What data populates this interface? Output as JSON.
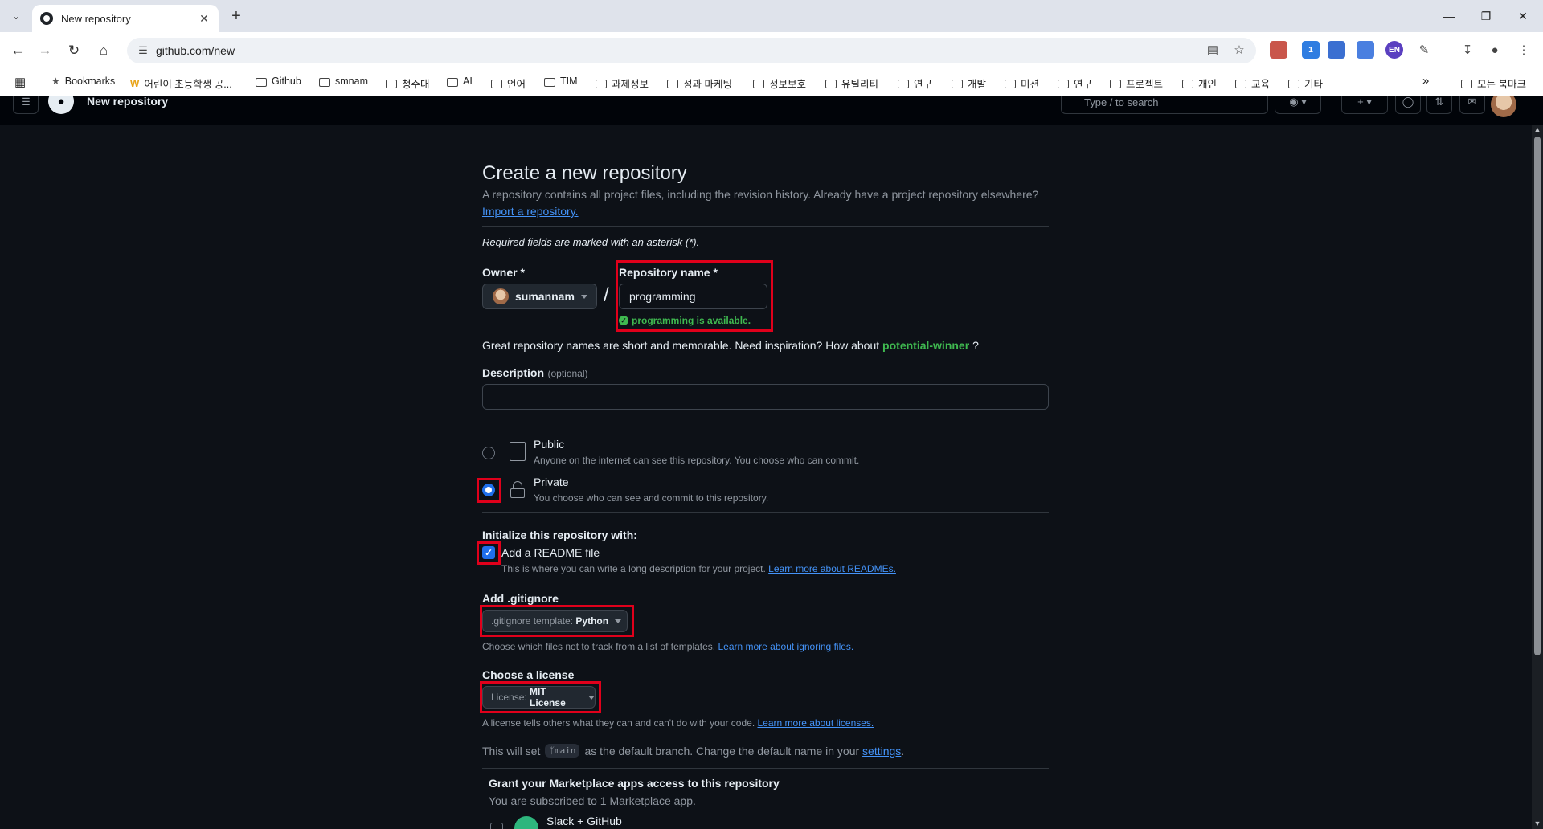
{
  "browser": {
    "tab_title": "New repository",
    "url": "github.com/new",
    "extension_badge": "1",
    "extension_en": "EN",
    "bookmarks": [
      "Bookmarks",
      "어린이 초등학생 공...",
      "Github",
      "smnam",
      "청주대",
      "AI",
      "언어",
      "TIM",
      "과제정보",
      "성과 마케팅",
      "정보보호",
      "유틸리티",
      "연구",
      "개발",
      "미션",
      "연구",
      "프로젝트",
      "개인",
      "교육",
      "기타"
    ],
    "all_bookmarks": "모든 북마크"
  },
  "gh_header": {
    "context": "New repository",
    "search_placeholder": "Type / to search"
  },
  "form": {
    "title": "Create a new repository",
    "subtitle": "A repository contains all project files, including the revision history. Already have a project repository elsewhere?",
    "import_link": "Import a repository.",
    "required_note": "Required fields are marked with an asterisk (*).",
    "owner_label": "Owner *",
    "owner_value": "sumannam",
    "slash": "/",
    "repo_name_label": "Repository name *",
    "repo_name_value": "programming",
    "availability": "programming is available.",
    "inspiration_text": "Great repository names are short and memorable. Need inspiration? How about",
    "inspiration_suggestion": "potential-winner",
    "inspiration_end": "?",
    "description_label": "Description",
    "description_optional": "(optional)",
    "description_value": "",
    "visibility": [
      {
        "label": "Public",
        "desc": "Anyone on the internet can see this repository. You choose who can commit.",
        "selected": false
      },
      {
        "label": "Private",
        "desc": "You choose who can see and commit to this repository.",
        "selected": true
      }
    ],
    "init_heading": "Initialize this repository with:",
    "readme_label": "Add a README file",
    "readme_checked": true,
    "readme_desc": "This is where you can write a long description for your project.",
    "readme_link": "Learn more about READMEs.",
    "gitignore_heading": "Add .gitignore",
    "gitignore_prefix": ".gitignore template:",
    "gitignore_value": "Python",
    "gitignore_desc": "Choose which files not to track from a list of templates.",
    "gitignore_link": "Learn more about ignoring files.",
    "license_heading": "Choose a license",
    "license_prefix": "License:",
    "license_value": "MIT License",
    "license_desc": "A license tells others what they can and can't do with your code.",
    "license_link": "Learn more about licenses.",
    "branch_text_1": "This will set",
    "branch_name": "main",
    "branch_text_2": "as the default branch. Change the default name in your",
    "branch_link": "settings",
    "branch_end": ".",
    "marketplace_heading": "Grant your Marketplace apps access to this repository",
    "marketplace_sub": "You are subscribed to 1 Marketplace app.",
    "marketplace_app": "Slack + GitHub"
  },
  "colors": {
    "highlight": "#e0001b",
    "accent": "#1f6feb",
    "link": "#4493f8",
    "success": "#3fb950"
  }
}
